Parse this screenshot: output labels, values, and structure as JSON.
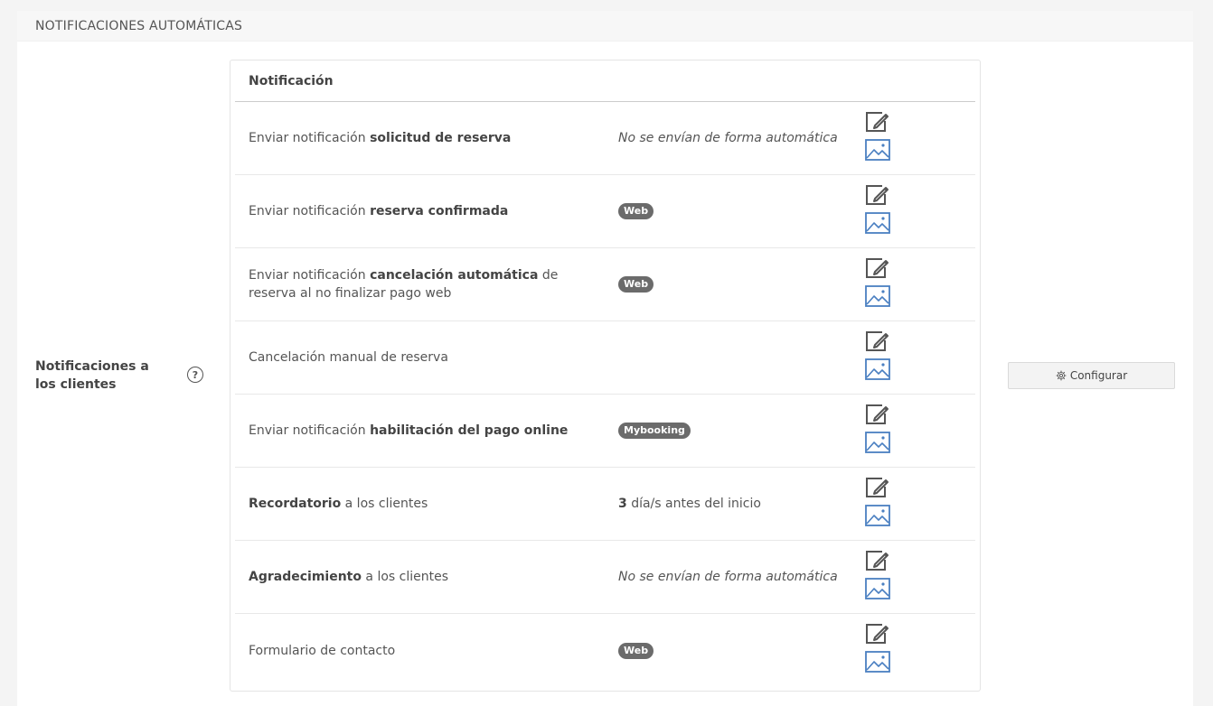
{
  "panel": {
    "title": "NOTIFICACIONES AUTOMÁTICAS"
  },
  "section": {
    "label": "Notificaciones a los clientes",
    "help_icon": "question-circle-icon",
    "configure_label": "Configurar",
    "configure_icon": "gear-icon"
  },
  "table": {
    "header": "Notificación",
    "rows": [
      {
        "name_parts": [
          "Enviar notificación ",
          "solicitud de reserva",
          ""
        ],
        "status_type": "italic",
        "status_text": "No se envían de forma automática"
      },
      {
        "name_parts": [
          "Enviar notificación ",
          "reserva confirmada",
          ""
        ],
        "status_type": "badge",
        "status_text": "Web"
      },
      {
        "name_parts": [
          "Enviar notificación ",
          "cancelación automática",
          " de reserva al no finalizar pago web"
        ],
        "status_type": "badge",
        "status_text": "Web"
      },
      {
        "name_parts": [
          "Cancelación manual de reserva",
          "",
          ""
        ],
        "status_type": "none",
        "status_text": ""
      },
      {
        "name_parts": [
          "Enviar notificación ",
          "habilitación del pago online",
          ""
        ],
        "status_type": "badge",
        "status_text": "Mybooking"
      },
      {
        "name_parts": [
          "",
          "Recordatorio",
          " a los clientes"
        ],
        "status_type": "days",
        "status_bold": "3",
        "status_text": " día/s antes del inicio"
      },
      {
        "name_parts": [
          "",
          "Agradecimiento",
          " a los clientes"
        ],
        "status_type": "italic",
        "status_text": "No se envían de forma automática"
      },
      {
        "name_parts": [
          "Formulario de contacto",
          "",
          ""
        ],
        "status_type": "badge",
        "status_text": "Web"
      }
    ],
    "edit_icon": "edit-pencil-icon",
    "image_icon": "image-icon"
  },
  "colors": {
    "edit_icon": "#555555",
    "image_icon": "#4a7fc1",
    "badge": "#6b6b6b"
  }
}
